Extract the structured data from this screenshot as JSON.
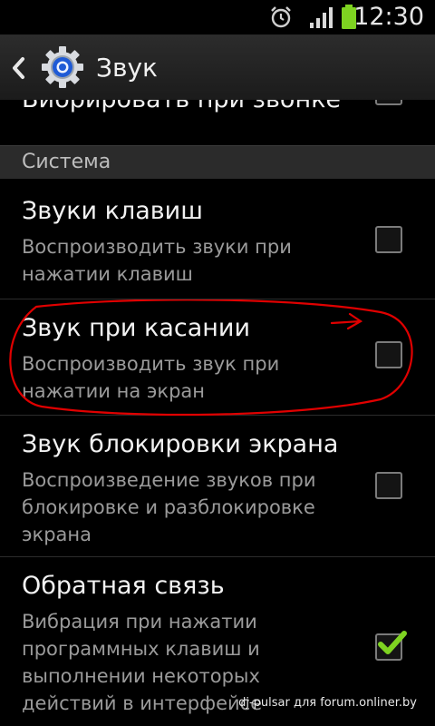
{
  "status_bar": {
    "time": "12:30",
    "icons": [
      "alarm-icon",
      "signal-icon",
      "battery-icon"
    ],
    "battery_color": "#7ed321"
  },
  "action_bar": {
    "title": "Звук",
    "back_icon": "back-arrow-icon",
    "app_icon": "gear-icon"
  },
  "partial_item": {
    "title": "Вибрировать при звонке",
    "checked": true
  },
  "section": {
    "label": "Система"
  },
  "items": [
    {
      "title": "Звуки клавиш",
      "summary_lines": [
        "Воспроизводить звуки при",
        "нажатии клавиш"
      ],
      "checked": false
    },
    {
      "title": "Звук при касании",
      "summary_lines": [
        "Воспроизводить звук при",
        "нажатии на экран"
      ],
      "checked": false
    },
    {
      "title": "Звук блокировки экрана",
      "summary_lines": [
        "Воспроизведение звуков при",
        "блокировке и разблокировке",
        "экрана"
      ],
      "checked": false
    },
    {
      "title": "Обратная связь",
      "summary_lines": [
        "Вибрация при нажатии",
        "программных клавиш и",
        "выполнении некоторых",
        "действий в интерфейсе"
      ],
      "checked": true
    }
  ],
  "accent_color": "#7ed321",
  "annotation_color": "#e00000",
  "watermark": "dj-pulsar для forum.onliner.by"
}
